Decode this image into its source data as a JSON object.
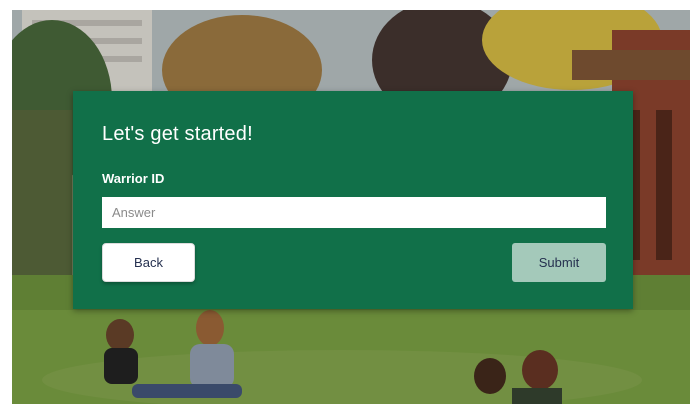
{
  "form": {
    "heading": "Let's get started!",
    "field_label": "Warrior ID",
    "field_placeholder": "Answer",
    "field_value": "",
    "back_label": "Back",
    "submit_label": "Submit"
  },
  "colors": {
    "card_background": "#117049",
    "submit_background": "#a4c9ba",
    "button_text": "#25304f"
  }
}
